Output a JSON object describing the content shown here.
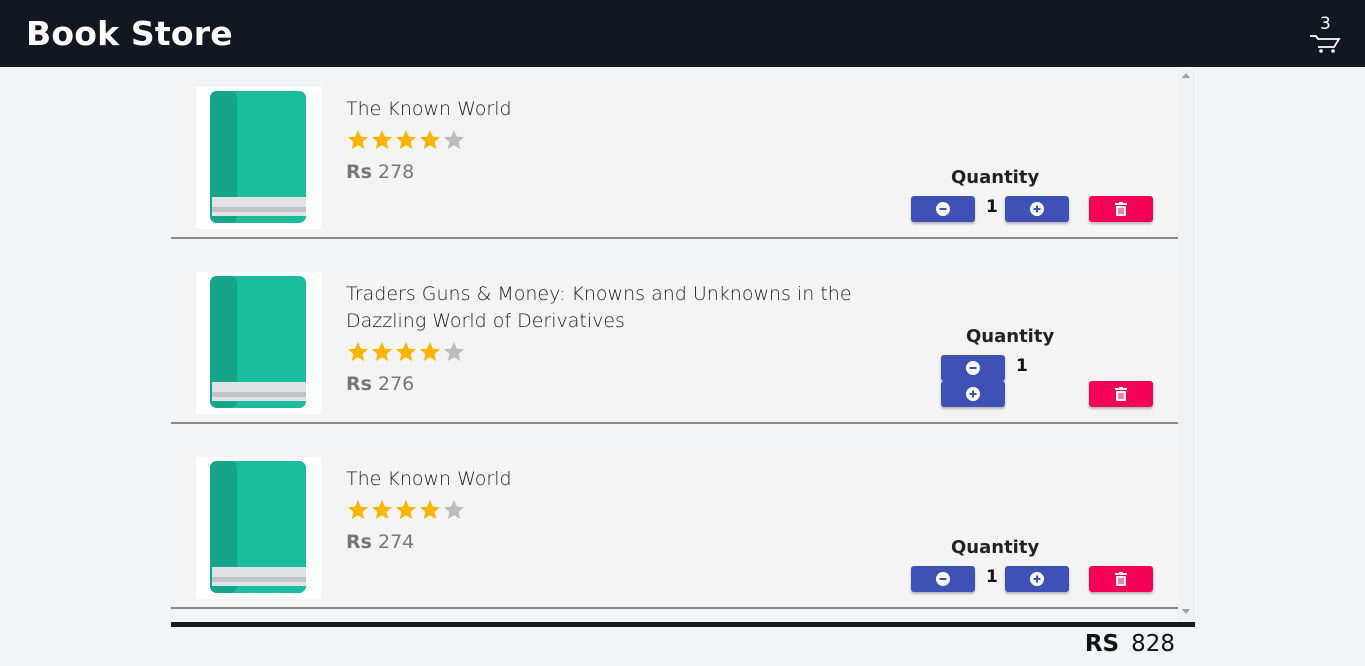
{
  "header": {
    "title": "Book Store",
    "cart_count": "3",
    "cart_icon": "cart-icon"
  },
  "items": [
    {
      "title": "The Known World",
      "rating": 4,
      "rating_max": 5,
      "currency": "Rs",
      "price": "278",
      "quantity_label": "Quantity",
      "quantity": "1"
    },
    {
      "title": "Traders Guns & Money: Knowns and Unknowns in the Dazzling World of Derivatives",
      "rating": 4,
      "rating_max": 5,
      "currency": "Rs",
      "price": "276",
      "quantity_label": "Quantity",
      "quantity": "1"
    },
    {
      "title": "The Known World",
      "rating": 4,
      "rating_max": 5,
      "currency": "Rs",
      "price": "274",
      "quantity_label": "Quantity",
      "quantity": "1"
    }
  ],
  "total": {
    "currency": "RS",
    "amount": "828"
  },
  "colors": {
    "header_bg": "#121821",
    "primary_button": "#3f51b5",
    "delete_button": "#f50057",
    "star_filled": "#ffb400",
    "star_empty": "#bdbdbd",
    "book_cover": "#1abc9c"
  }
}
